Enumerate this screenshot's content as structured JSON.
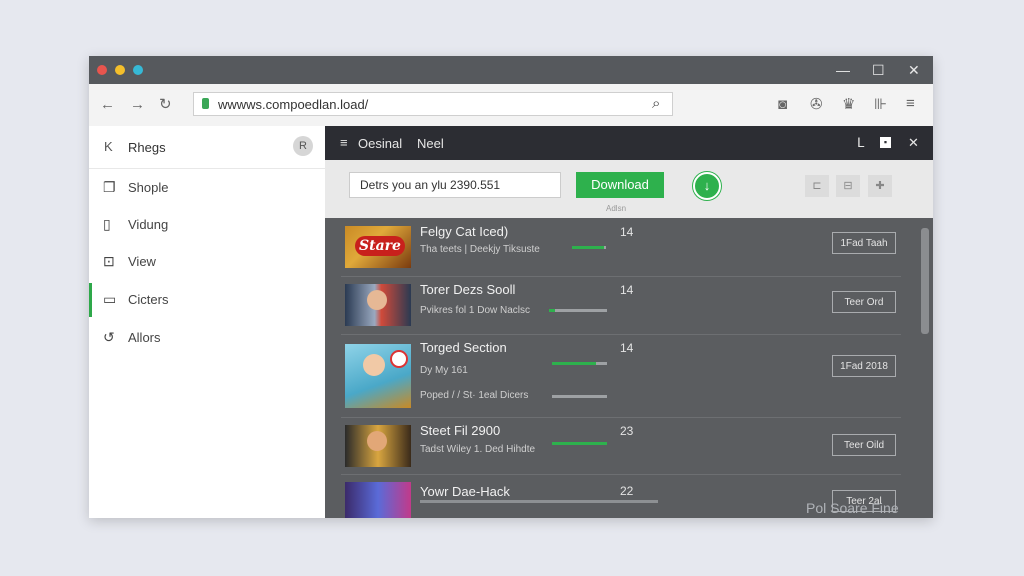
{
  "window": {
    "minimize": "—",
    "maximize": "☐",
    "close": "✕"
  },
  "toolbar": {
    "back": "←",
    "forward": "→",
    "refresh": "↻",
    "url": "wwwws.compoedlan.load/",
    "search_icon": "⌕",
    "ext_icons": [
      "◙",
      "✇",
      "♛",
      "⊪",
      "≡"
    ]
  },
  "sidebar": {
    "title": "Rhegs",
    "back_icon": "K",
    "badge": "R",
    "items": [
      {
        "label": "Shople",
        "icon": "❐"
      },
      {
        "label": "Vidung",
        "icon": "▯"
      },
      {
        "label": "View",
        "icon": "⊡"
      },
      {
        "label": "Cicters",
        "icon": "▭"
      },
      {
        "label": "Allors",
        "icon": "↺"
      }
    ]
  },
  "main": {
    "menu_icon": "≡",
    "title1": "Oesinal",
    "title2": "Neel",
    "header_icons": [
      "ᒪ",
      "▪",
      "✕"
    ],
    "download_input": "Detrs you an ylu 2390.551",
    "download_button": "Download",
    "download_icon": "↓",
    "download_hint": "Adlsn",
    "right_icons": [
      "⊏",
      "⊟",
      "✚"
    ]
  },
  "downloads": [
    {
      "title": "Felgy Cat Iced)",
      "subtitle": "Tha teets | Deekjy Tiksuste",
      "count": "14",
      "action": "1Fad Taah",
      "progress": 0.95
    },
    {
      "title": "Torer Dezs Sooll",
      "subtitle": "Pvikres fol 1 Dow Naclsc",
      "count": "14",
      "action": "Teer Ord",
      "progress": 0.1
    },
    {
      "title": "Torged Section",
      "subtitle": "Dy My 161",
      "subtitle2": "Poped / / St· 1eal Dicers",
      "count": "14",
      "action": "1Fad 2018",
      "progress": 0.8
    },
    {
      "title": "Steet Fil 2900",
      "subtitle": "Tadst Wiley 1. Ded Hihdte",
      "count": "23",
      "action": "Teer Oild",
      "progress": 1.0
    },
    {
      "title": "Yowr Dae-Hack",
      "subtitle": "",
      "count": "22",
      "action": "Teer 2al",
      "progress": 0.0
    }
  ],
  "thumbnail_labels": [
    "Stare"
  ],
  "watermark": "Pol Soare Fine"
}
